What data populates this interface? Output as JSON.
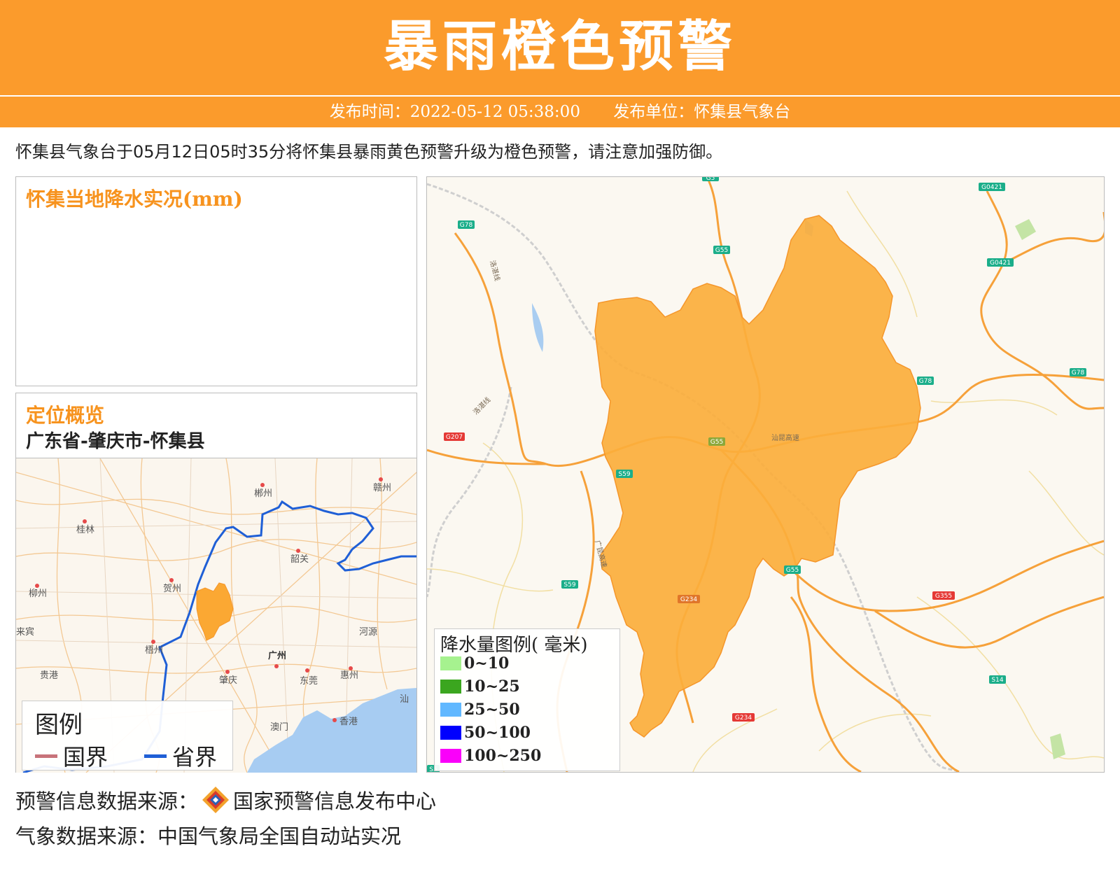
{
  "header": {
    "title": "暴雨橙色预警",
    "publish_time": "发布时间：2022-05-12 05:38:00",
    "publisher": "发布单位：怀集县气象台"
  },
  "description": "怀集县气象台于05月12日05时35分将怀集县暴雨黄色预警升级为橙色预警，请注意加强防御。",
  "precip_panel": {
    "title": "怀集当地降水实况(mm)"
  },
  "location_panel": {
    "title": "定位概览",
    "path": "广东省-肇庆市-怀集县",
    "cities": [
      "郴州",
      "赣州",
      "桂林",
      "韶关",
      "贺州",
      "柳州",
      "来宾",
      "梧州",
      "河源",
      "广州",
      "贵港",
      "肇庆",
      "东莞",
      "惠州",
      "澳门",
      "香港",
      "汕"
    ],
    "legend": {
      "title": "图例",
      "national": "国界",
      "provincial": "省界",
      "national_color": "#c8737a",
      "provincial_color": "#1f5fd6"
    }
  },
  "main_map": {
    "warning_fill": "#fbae3c",
    "roads": [
      "G78",
      "G55",
      "G0421",
      "G0421",
      "G78",
      "G78",
      "G207",
      "S59",
      "S59",
      "G55",
      "G55",
      "G234",
      "G355",
      "S14",
      "G234",
      "S5",
      "G5",
      "汕昆高速",
      "洛湛线",
      "洛湛线",
      "广昆高速"
    ],
    "legend": {
      "title": "降水量图例( 毫米)",
      "items": [
        {
          "label": "0~10",
          "color": "#a6f28f"
        },
        {
          "label": "10~25",
          "color": "#3ba61f"
        },
        {
          "label": "25~50",
          "color": "#61b8ff"
        },
        {
          "label": "50~100",
          "color": "#0000fe"
        },
        {
          "label": "100~250",
          "color": "#fa00fa"
        }
      ]
    }
  },
  "footer": {
    "source1_prefix": "预警信息数据来源：",
    "source1_name": "国家预警信息发布中心",
    "source2": "气象数据来源：中国气象局全国自动站实况"
  }
}
